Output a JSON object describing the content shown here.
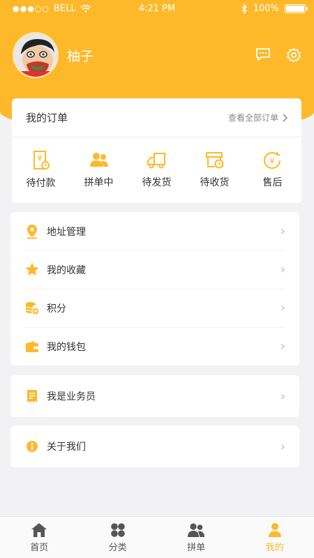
{
  "status_bar": {
    "carrier": "BELL",
    "time": "4:21 PM",
    "battery": "100%"
  },
  "profile": {
    "username": "柚子"
  },
  "orders": {
    "title": "我的订单",
    "view_all": "查看全部订单",
    "items": [
      {
        "label": "待付款",
        "icon": "payment-pending-icon"
      },
      {
        "label": "拼单中",
        "icon": "group-buy-icon"
      },
      {
        "label": "待发货",
        "icon": "truck-icon"
      },
      {
        "label": "待收货",
        "icon": "package-receive-icon"
      },
      {
        "label": "售后",
        "icon": "after-sales-icon"
      }
    ]
  },
  "menu": [
    {
      "label": "地址管理",
      "icon": "location-pin-icon"
    },
    {
      "label": "我的收藏",
      "icon": "star-icon"
    },
    {
      "label": "积分",
      "icon": "coins-icon"
    },
    {
      "label": "我的钱包",
      "icon": "wallet-icon"
    }
  ],
  "salesman": {
    "label": "我是业务员",
    "icon": "receipt-icon"
  },
  "about": {
    "label": "关于我们",
    "icon": "info-icon"
  },
  "tabbar": [
    {
      "label": "首页",
      "icon": "home-icon",
      "active": false
    },
    {
      "label": "分类",
      "icon": "category-icon",
      "active": false
    },
    {
      "label": "拼单",
      "icon": "group-icon",
      "active": false
    },
    {
      "label": "我的",
      "icon": "person-icon",
      "active": true
    }
  ],
  "colors": {
    "accent": "#fdb92a",
    "background": "#f2f2f4",
    "icon_gray": "#555555"
  }
}
